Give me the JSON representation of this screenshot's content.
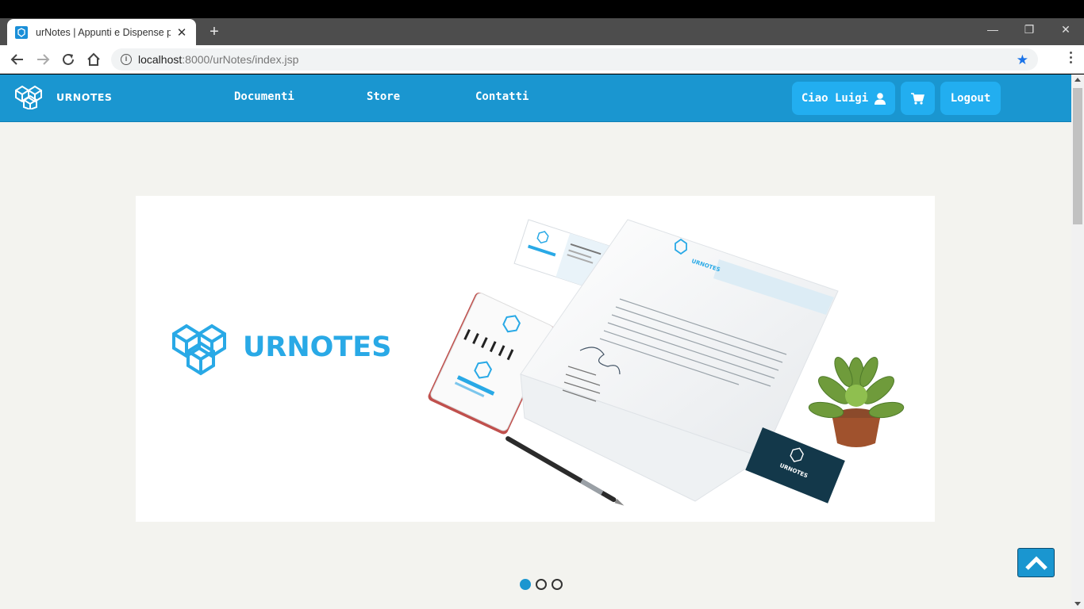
{
  "browser": {
    "tab_title": "urNotes | Appunti e Dispense pe",
    "tab_close": "✕",
    "new_tab": "+",
    "url_host": "localhost",
    "url_rest": ":8000/urNotes/index.jsp",
    "window_controls": {
      "minimize": "—",
      "restore": "❐",
      "close": "✕"
    }
  },
  "site": {
    "brand": "URNOTES",
    "nav": {
      "documents": "Documenti",
      "store": "Store",
      "contacts": "Contatti"
    },
    "greeting": "Ciao Luigi",
    "logout": "Logout"
  },
  "hero": {
    "logo_text": "URNOTES",
    "mockup_brand_card": "URNOTES",
    "mockup_letter_brand": "URNOTES"
  },
  "carousel": {
    "slides": 3,
    "active": 1
  },
  "colors": {
    "brand": "#1a96d0",
    "logo": "#29a9e6",
    "page_bg": "#f3f3ef"
  },
  "icons": [
    "user-icon",
    "cart-icon",
    "chevron-up-icon",
    "star-icon",
    "info-icon"
  ]
}
